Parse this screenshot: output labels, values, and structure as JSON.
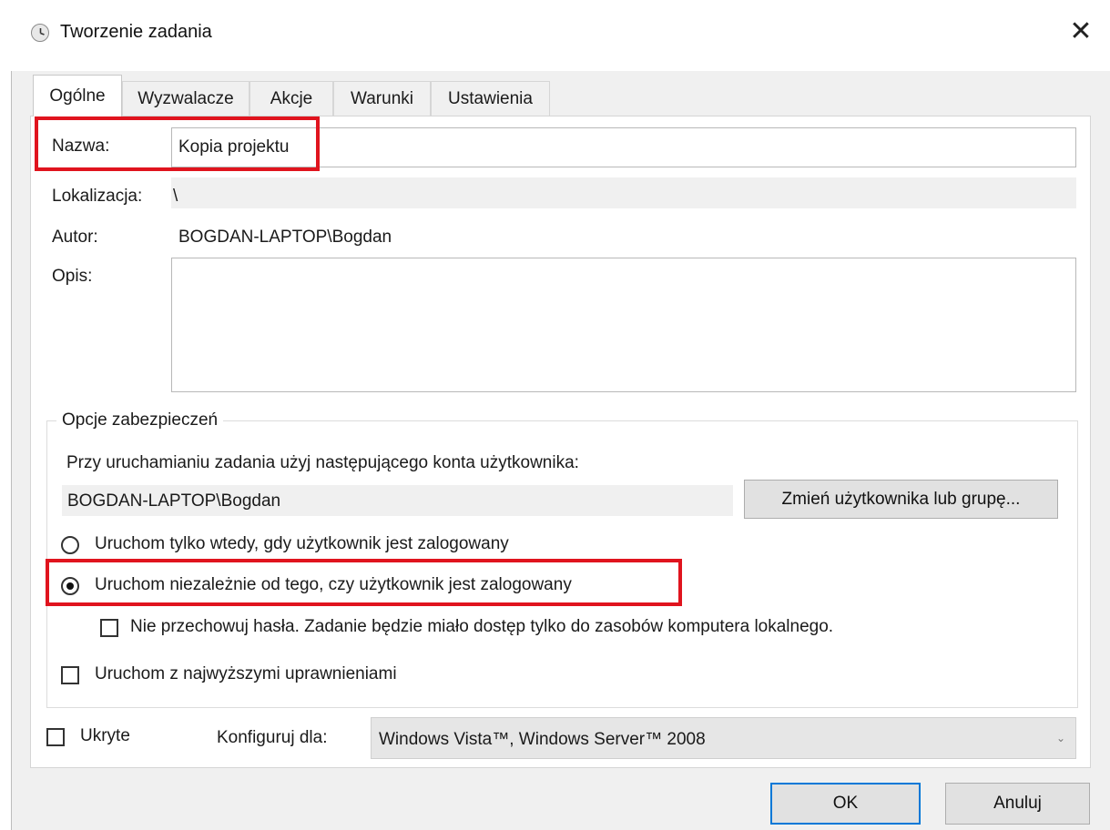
{
  "window": {
    "title": "Tworzenie zadania",
    "close_glyph": "✕"
  },
  "tabs": [
    {
      "label": "Ogólne",
      "active": true
    },
    {
      "label": "Wyzwalacze",
      "active": false
    },
    {
      "label": "Akcje",
      "active": false
    },
    {
      "label": "Warunki",
      "active": false
    },
    {
      "label": "Ustawienia",
      "active": false
    }
  ],
  "general": {
    "name_label": "Nazwa:",
    "name_value": "Kopia projektu",
    "location_label": "Lokalizacja:",
    "location_value": "\\",
    "author_label": "Autor:",
    "author_value": "BOGDAN-LAPTOP\\Bogdan",
    "description_label": "Opis:",
    "description_value": ""
  },
  "security": {
    "group_label": "Opcje zabezpieczeń",
    "account_prompt": "Przy uruchamianiu zadania użyj następującego konta użytkownika:",
    "account_value": "BOGDAN-LAPTOP\\Bogdan",
    "change_user_button": "Zmień użytkownika lub grupę...",
    "radio_logged_on_only": {
      "label": "Uruchom tylko wtedy, gdy użytkownik jest zalogowany",
      "checked": false
    },
    "radio_whether_logged_on": {
      "label": "Uruchom niezależnie od tego, czy użytkownik jest zalogowany",
      "checked": true
    },
    "do_not_store_password": {
      "label": "Nie przechowuj hasła. Zadanie będzie miało dostęp tylko do zasobów komputera lokalnego.",
      "checked": false
    },
    "highest_privileges": {
      "label": "Uruchom z najwyższymi uprawnieniami",
      "checked": false
    }
  },
  "bottom": {
    "hidden": {
      "label": "Ukryte",
      "checked": false
    },
    "configure_for_label": "Konfiguruj dla:",
    "configure_for_value": "Windows Vista™, Windows Server™ 2008"
  },
  "buttons": {
    "ok": "OK",
    "cancel": "Anuluj"
  },
  "colors": {
    "highlight": "#e0141e",
    "default_button_border": "#0078d7",
    "dialog_background": "#f0f0f0"
  }
}
